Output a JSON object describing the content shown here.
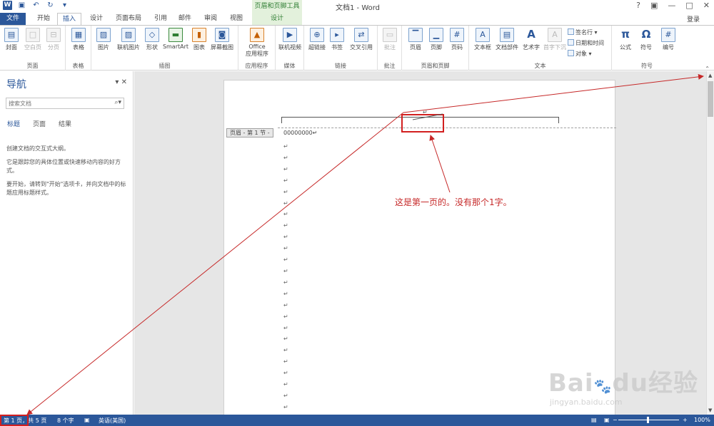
{
  "titlebar": {
    "app_icon": "word-icon",
    "qat_icons": [
      "save-icon",
      "undo-icon",
      "redo-icon",
      "customize-icon"
    ],
    "context_group": "页眉和页脚工具",
    "doc_title": "文档1 - Word",
    "controls": [
      "?",
      "▣",
      "—",
      "□",
      "✕"
    ]
  },
  "tabs": {
    "file": "文件",
    "items": [
      "开始",
      "插入",
      "设计",
      "页面布局",
      "引用",
      "邮件",
      "审阅",
      "视图"
    ],
    "context_tab": "设计",
    "login": "登录"
  },
  "ribbon": {
    "groups": {
      "pages": {
        "label": "页面",
        "buttons": [
          "封面",
          "空白页",
          "分页"
        ]
      },
      "tables": {
        "label": "表格",
        "buttons": [
          "表格"
        ]
      },
      "illustrations": {
        "label": "插图",
        "buttons": [
          "图片",
          "联机图片",
          "形状",
          "SmartArt",
          "图表",
          "屏幕截图"
        ]
      },
      "apps": {
        "label": "应用程序",
        "buttons": [
          "Office",
          "应用程序"
        ]
      },
      "media": {
        "label": "媒体",
        "buttons": [
          "联机视频"
        ]
      },
      "links": {
        "label": "链接",
        "buttons": [
          "超链接",
          "书签",
          "交叉引用"
        ]
      },
      "comments": {
        "label": "批注",
        "buttons": [
          "批注"
        ]
      },
      "header_footer": {
        "label": "页眉和页脚",
        "buttons": [
          "页眉",
          "页脚",
          "页码"
        ]
      },
      "text": {
        "label": "文本",
        "buttons": [
          "文本框",
          "文档部件",
          "艺术字",
          "首字下沉"
        ],
        "small": [
          "签名行",
          "日期和时间",
          "对象"
        ]
      },
      "symbols": {
        "label": "符号",
        "buttons": [
          "公式",
          "符号",
          "编号"
        ]
      }
    }
  },
  "nav": {
    "title": "导航",
    "search_placeholder": "搜索文档",
    "tabs": [
      "标题",
      "页面",
      "结果"
    ],
    "text1": "创建文档的交互式大纲。",
    "text2": "它是跟踪您的具体位置或快速移动内容的好方式。",
    "text3": "要开始，请转到\"开始\"选项卡，并向文档中的标题应用标题样式。"
  },
  "document": {
    "header_tag": "页眉 - 第 1 节 -",
    "body_text": "00000000↵",
    "header_mark": "↵",
    "para_marks": "↵"
  },
  "annotation": {
    "text": "这是第一页的。没有那个1字。"
  },
  "status": {
    "page": "第 1 页，共 5 页",
    "words": "8 个字",
    "language": "英语(美国)",
    "zoom": "100%"
  },
  "watermark": {
    "brand": "Bai经验",
    "url": "jingyan.baidu.com"
  },
  "colors": {
    "word_blue": "#2b579a",
    "context_green": "#2e7d32",
    "annotation_red": "#d21f1f"
  }
}
